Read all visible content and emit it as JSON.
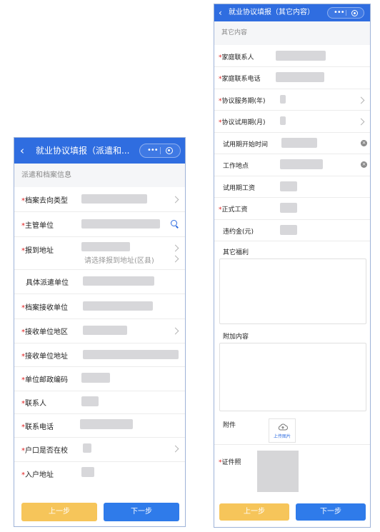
{
  "left": {
    "title": "就业协议填报（派遣和...",
    "back": "‹",
    "section": "派遣和档案信息",
    "fields": [
      {
        "label": "档案去向类型",
        "required": true
      },
      {
        "label": "主管单位",
        "required": true
      },
      {
        "label": "报到地址",
        "required": true,
        "hint": "请选择报到地址(区县)"
      },
      {
        "label": "具体派遣单位",
        "required": false
      },
      {
        "label": "档案接收单位",
        "required": true
      },
      {
        "label": "接收单位地区",
        "required": true
      },
      {
        "label": "接收单位地址",
        "required": true
      },
      {
        "label": "单位邮政编码",
        "required": true
      },
      {
        "label": "联系人",
        "required": true
      },
      {
        "label": "联系电话",
        "required": true
      },
      {
        "label": "户口是否在校",
        "required": true
      },
      {
        "label": "入户地址",
        "required": true
      }
    ],
    "prev_label": "上一步",
    "next_label": "下一步"
  },
  "right": {
    "title": "就业协议填报（其它内容）",
    "back": "‹",
    "section": "其它内容",
    "fields": [
      {
        "label": "家庭联系人",
        "required": true
      },
      {
        "label": "家庭联系电话",
        "required": true
      },
      {
        "label": "协议服务期(年)",
        "required": true
      },
      {
        "label": "协议试用期(月)",
        "required": true
      },
      {
        "label": "试用期开始时间",
        "required": false
      },
      {
        "label": "工作地点",
        "required": false
      },
      {
        "label": "试用期工资",
        "required": false
      },
      {
        "label": "正式工资",
        "required": true
      },
      {
        "label": "违约金(元)",
        "required": false
      },
      {
        "label": "其它福利",
        "required": false
      },
      {
        "label": "附加内容",
        "required": false
      },
      {
        "label": "附件",
        "required": false
      },
      {
        "label": "证件照",
        "required": true
      }
    ],
    "upload_label": "上传图片",
    "prev_label": "上一步",
    "next_label": "下一步"
  },
  "colors": {
    "primary": "#2f6de0",
    "required": "#e02020",
    "prev_button": "#f6c55a",
    "next_button": "#2f7bea"
  },
  "icons": [
    "back-icon",
    "more-dots-icon",
    "close-target-icon",
    "chevron-right-icon",
    "search-icon",
    "clear-icon",
    "cloud-upload-icon"
  ]
}
